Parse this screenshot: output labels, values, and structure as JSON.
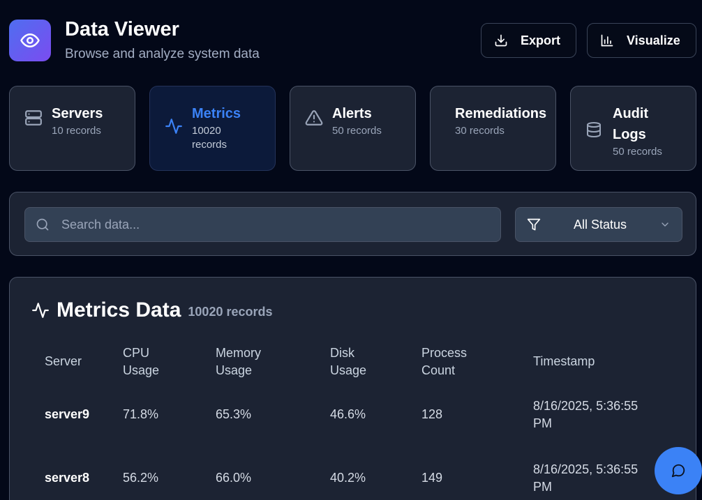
{
  "app": {
    "title": "Data Viewer",
    "subtitle": "Browse and analyze system data",
    "logo_icon": "eye-icon"
  },
  "toolbar": {
    "export_label": "Export",
    "export_icon": "download-icon",
    "visualize_label": "Visualize",
    "visualize_icon": "bar-chart-icon"
  },
  "categories": [
    {
      "title": "Servers",
      "count": "10 records",
      "icon": "server-icon",
      "active": false
    },
    {
      "title": "Metrics",
      "count": "10020 records",
      "icon": "activity-icon",
      "active": true
    },
    {
      "title": "Alerts",
      "count": "50 records",
      "icon": "alert-triangle-icon",
      "active": false
    },
    {
      "title": "Remediations",
      "count": "30 records",
      "icon": "",
      "active": false
    },
    {
      "title": "Audit Logs",
      "count": "50 records",
      "icon": "database-icon",
      "active": false
    }
  ],
  "search": {
    "placeholder": "Search data...",
    "value": "",
    "icon": "search-icon"
  },
  "filter": {
    "selected": "All Status",
    "icon": "filter-icon"
  },
  "table": {
    "title": "Metrics Data",
    "count": "10020 records",
    "icon": "activity-icon",
    "columns": [
      "Server",
      "CPU Usage",
      "Memory Usage",
      "Disk Usage",
      "Process Count",
      "Timestamp"
    ],
    "rows": [
      [
        "server9",
        "71.8%",
        "65.3%",
        "46.6%",
        "128",
        "8/16/2025, 5:36:55 PM"
      ],
      [
        "server8",
        "56.2%",
        "66.0%",
        "40.2%",
        "149",
        "8/16/2025, 5:36:55 PM"
      ]
    ]
  },
  "chat": {
    "icon": "message-circle-icon"
  },
  "colors": {
    "background": "#030818",
    "panel": "#1c2333",
    "accent": "#3b82f6",
    "logo_gradient_start": "#4f6ef0",
    "logo_gradient_end": "#7b4cf0"
  }
}
